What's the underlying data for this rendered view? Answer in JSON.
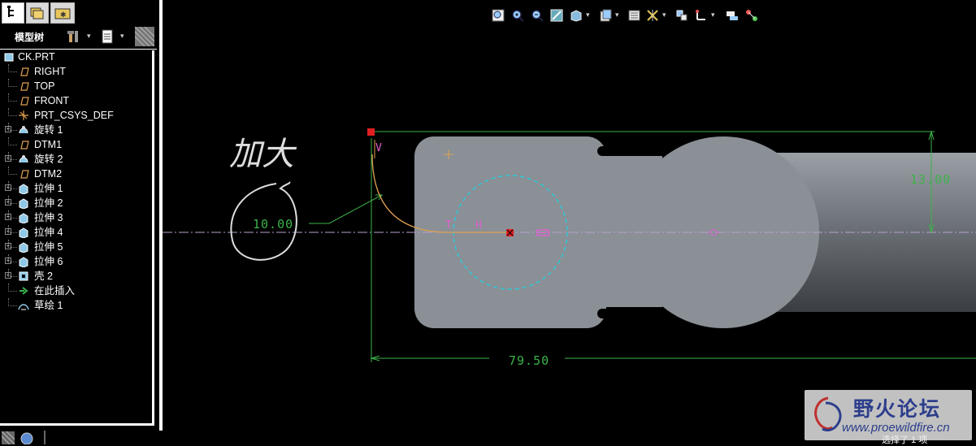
{
  "model_tree": {
    "title": "模型树",
    "items": [
      {
        "label": "CK.PRT",
        "icon": "part-icon"
      },
      {
        "label": "RIGHT",
        "icon": "datum-plane-icon"
      },
      {
        "label": "TOP",
        "icon": "datum-plane-icon"
      },
      {
        "label": "FRONT",
        "icon": "datum-plane-icon"
      },
      {
        "label": "PRT_CSYS_DEF",
        "icon": "csys-icon"
      },
      {
        "label": "旋转 1",
        "icon": "revolve-icon",
        "expandable": true
      },
      {
        "label": "DTM1",
        "icon": "datum-plane-icon"
      },
      {
        "label": "旋转 2",
        "icon": "revolve-icon",
        "expandable": true
      },
      {
        "label": "DTM2",
        "icon": "datum-plane-icon"
      },
      {
        "label": "拉伸 1",
        "icon": "extrude-icon",
        "expandable": true
      },
      {
        "label": "拉伸 2",
        "icon": "extrude-icon",
        "expandable": true
      },
      {
        "label": "拉伸 3",
        "icon": "extrude-icon",
        "expandable": true
      },
      {
        "label": "拉伸 4",
        "icon": "extrude-icon",
        "expandable": true
      },
      {
        "label": "拉伸 5",
        "icon": "extrude-icon",
        "expandable": true
      },
      {
        "label": "拉伸 6",
        "icon": "extrude-icon",
        "expandable": true
      },
      {
        "label": "壳 2",
        "icon": "shell-icon",
        "expandable": true
      },
      {
        "label": "在此插入",
        "icon": "insert-arrow-icon"
      },
      {
        "label": "草绘 1",
        "icon": "sketch-icon"
      }
    ]
  },
  "sketch": {
    "dim_radius": "10.00",
    "dim_height": "13.00",
    "dim_length": "79.50",
    "label_v": "V",
    "label_t": "T",
    "label_h": "H",
    "annotation_text": "加大"
  },
  "view_toolbar": {
    "tools": [
      "refit-icon",
      "zoom-in-icon",
      "zoom-out-icon",
      "repaint-icon",
      "shading-icon",
      "saved-views-icon",
      "layers-icon",
      "datum-display-icon",
      "spin-center-icon",
      "csys-display-icon",
      "annotation-display-icon",
      "sketch-display-icon"
    ]
  },
  "status_bar": {
    "text": "选择了 1 项"
  },
  "watermark": {
    "title": "野火论坛",
    "url": "www.proewildfire.cn"
  },
  "colors": {
    "background": "#000000",
    "part_gray": "#8a9096",
    "dimension_green": "#3cb24a",
    "sketch_orange": "#e0a050",
    "circle_cyan": "#20d0e0",
    "constraint_magenta": "#e060d0",
    "highlight_red": "#e02020"
  }
}
